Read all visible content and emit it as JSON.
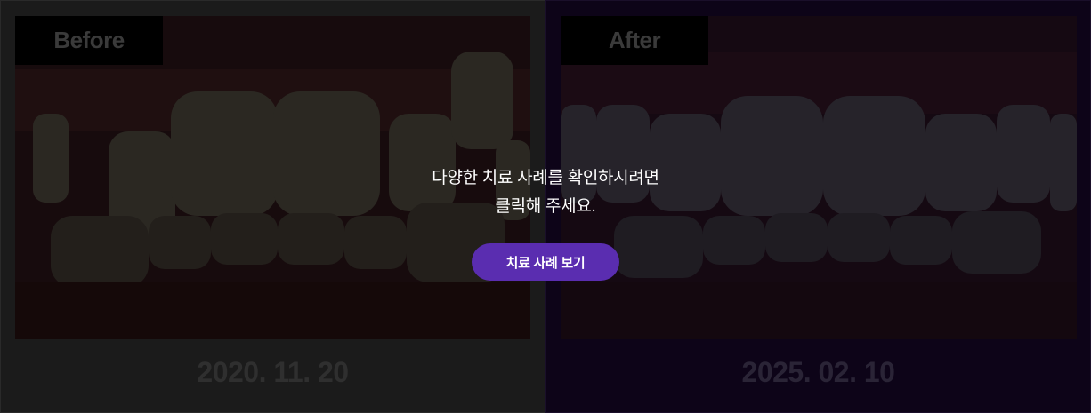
{
  "before": {
    "tag": "Before",
    "date": "2020. 11. 20"
  },
  "after": {
    "tag": "After",
    "date": "2025. 02. 10"
  },
  "overlay": {
    "line1": "다양한 치료 사례를 확인하시려면",
    "line2": "클릭해 주세요.",
    "button_label": "치료 사례 보기"
  },
  "colors": {
    "accent": "#5a2db0",
    "before_bg": "#1b1b1b",
    "after_bg": "#0d0418"
  }
}
